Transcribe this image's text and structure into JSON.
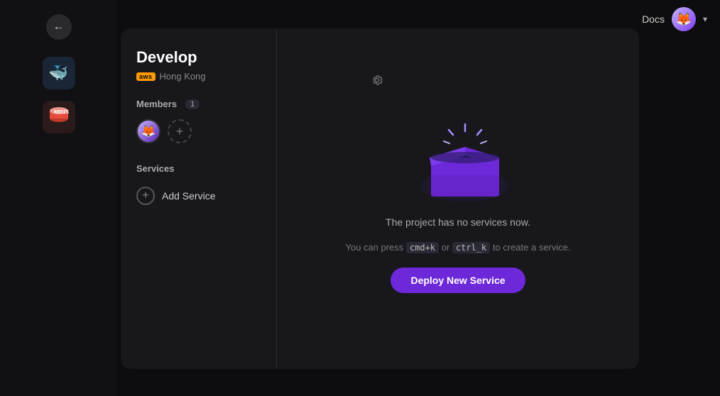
{
  "topbar": {
    "docs_label": "Docs",
    "chevron": "▾"
  },
  "sidebar": {
    "back_icon": "←",
    "icons": [
      {
        "name": "docker",
        "emoji": "🐳"
      },
      {
        "name": "redis",
        "emoji": "🟥"
      }
    ]
  },
  "card": {
    "project_title": "Develop",
    "aws_badge": "aws",
    "region": "Hong Kong",
    "settings_icon": "⚙",
    "members_label": "Members",
    "members_count": "1",
    "services_label": "Services",
    "add_service_label": "Add Service",
    "member_avatar_letter": "🦊"
  },
  "empty_state": {
    "title_text": "The project has no services now.",
    "subtitle_text": "You can press cmd+k or ctrl_k to create a service.",
    "deploy_button_label": "Deploy New Service"
  }
}
